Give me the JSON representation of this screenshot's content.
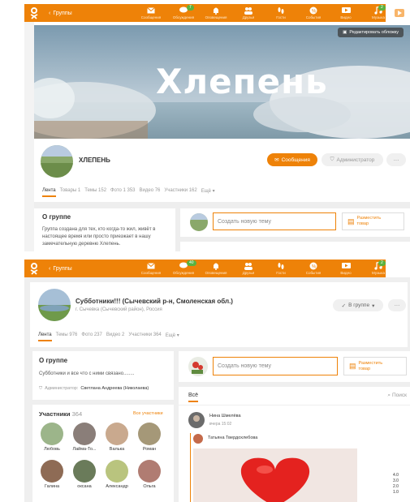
{
  "nav": {
    "back_label": "Группы",
    "items": [
      {
        "label": "Сообщения",
        "icon": "envelope-icon",
        "badge": ""
      },
      {
        "label": "Обсуждения",
        "icon": "chat-icon",
        "badge": "7"
      },
      {
        "label": "Оповещения",
        "icon": "bell-icon",
        "badge": ""
      },
      {
        "label": "Друзья",
        "icon": "friends-icon",
        "badge": ""
      },
      {
        "label": "Гости",
        "icon": "footprints-icon",
        "badge": ""
      },
      {
        "label": "События",
        "icon": "events-icon",
        "badge": ""
      },
      {
        "label": "Видео",
        "icon": "video-icon",
        "badge": ""
      },
      {
        "label": "Музыка",
        "icon": "music-icon",
        "badge": "2"
      }
    ],
    "items2_badges": {
      "discussions": "40",
      "music": "2"
    }
  },
  "group1": {
    "cover_title": "Хлепень",
    "edit_cover": "Редактировать обложку",
    "name": "ХЛЕПЕНЬ",
    "messages_btn": "Сообщения",
    "admin_btn": "Администратор",
    "more_btn": "···",
    "tabs": [
      "Лента",
      "Товары 1",
      "Темы 152",
      "Фото 1 353",
      "Видео 76",
      "Участники 162",
      "Ещё ▾"
    ],
    "about_title": "О группе",
    "about_text": "Группа создана для тех, кто когда-то жил, живёт в настоящее время или просто приезжает в нашу замечательную деревню Хлепень.",
    "new_topic": "Создать новую тему",
    "market_btn": "Разместить товар"
  },
  "group2": {
    "name": "Субботники!!! (Сычевский р-н, Смоленская обл.)",
    "location": "г. Сычевка (Сычевский район), Россия",
    "in_group_btn": "В группе",
    "more_btn": "···",
    "tabs": [
      "Лента",
      "Темы 976",
      "Фото 237",
      "Видео 2",
      "Участники 364",
      "Ещё ▾"
    ],
    "about_title": "О группе",
    "about_text": "Субботники и все что с ними связано........",
    "admin_label": "Администратор:",
    "admin_name": "Светлана Андреева (Николаева)",
    "members_title": "Участники",
    "members_count": "364",
    "all_members": "Все участники",
    "members": [
      "Любовь",
      "Лайма-То...",
      "Валька",
      "Роман",
      "Галина",
      "оксана",
      "Александр",
      "Ольга"
    ],
    "new_topic": "Создать новую тему",
    "market_btn": "Разместить товар",
    "feed_tab": "Всё",
    "search": "Поиск",
    "post_author": "Нина Шмелёва",
    "post_time": "вчера 15:02",
    "repost_author": "Татьяна Твердохлебова"
  },
  "side_numbers": [
    "4.0",
    "3.0",
    "2.0",
    "1.0"
  ],
  "colors": {
    "accent": "#ee8208",
    "badge": "#59b340"
  }
}
